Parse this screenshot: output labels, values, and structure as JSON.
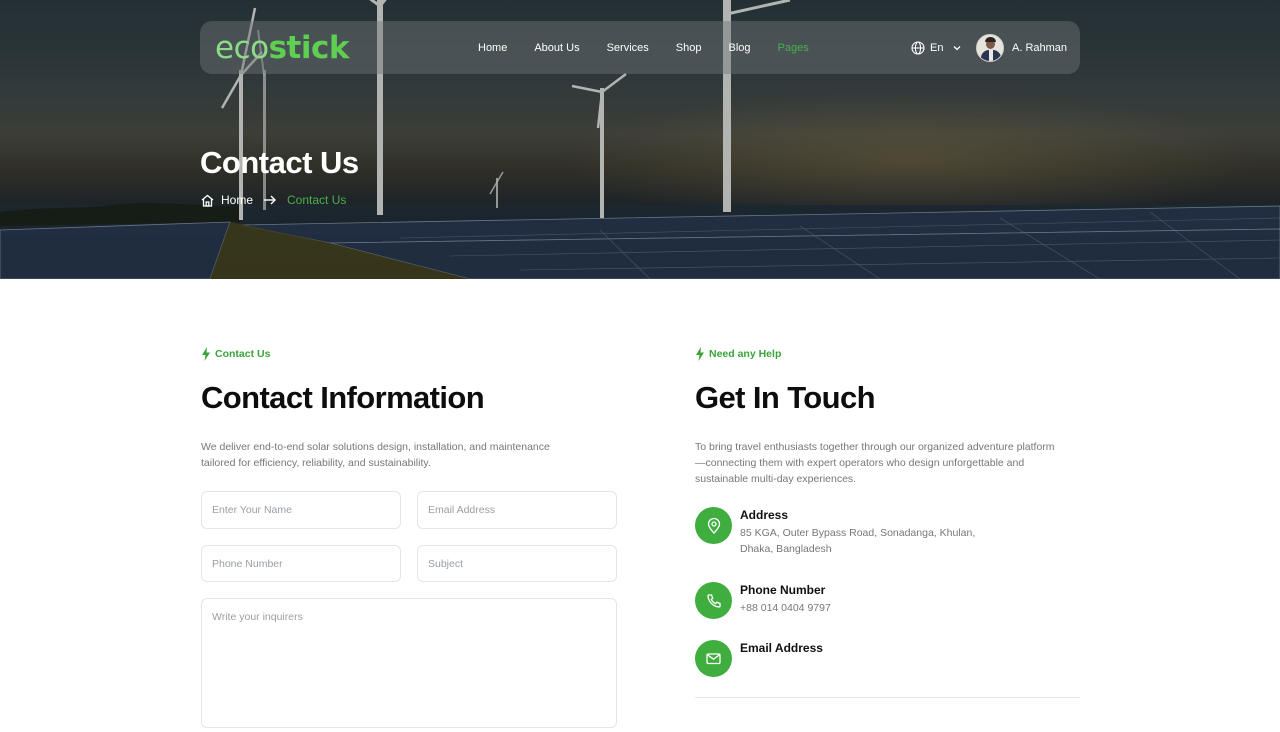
{
  "brand": {
    "logo_light": "eco",
    "logo_bold": "stick",
    "accent": "#4caf50"
  },
  "nav": {
    "items": [
      {
        "label": "Home",
        "active": false
      },
      {
        "label": "About Us",
        "active": false
      },
      {
        "label": "Services",
        "active": false
      },
      {
        "label": "Shop",
        "active": false
      },
      {
        "label": "Blog",
        "active": false
      },
      {
        "label": "Pages",
        "active": true
      }
    ],
    "language": "En",
    "user_name": "A. Rahman"
  },
  "hero": {
    "title": "Contact Us",
    "breadcrumb": {
      "home": "Home",
      "current": "Contact Us"
    }
  },
  "contact_info": {
    "eyebrow": "Contact Us",
    "title": "Contact Information",
    "description": "We deliver end-to-end solar solutions design, installation, and maintenance tailored for efficiency, reliability, and sustainability.",
    "form": {
      "name_placeholder": "Enter Your Name",
      "email_placeholder": "Email Address",
      "phone_placeholder": "Phone Number",
      "subject_placeholder": "Subject",
      "message_placeholder": "Write your inquirers"
    }
  },
  "get_in_touch": {
    "eyebrow": "Need any Help",
    "title": "Get In Touch",
    "description": "To bring travel enthusiasts together through our organized adventure platform—connecting them with expert operators who design unforgettable and sustainable multi-day experiences.",
    "address": {
      "title": "Address",
      "line1": "85 KGA, Outer Bypass Road, Sonadanga, Khulan,",
      "line2": "Dhaka, Bangladesh",
      "icon": "map-pin-icon"
    },
    "phone": {
      "title": "Phone Number",
      "value": "+88 014 0404 9797",
      "icon": "phone-icon"
    },
    "email": {
      "title": "Email Address",
      "icon": "mail-icon"
    }
  }
}
